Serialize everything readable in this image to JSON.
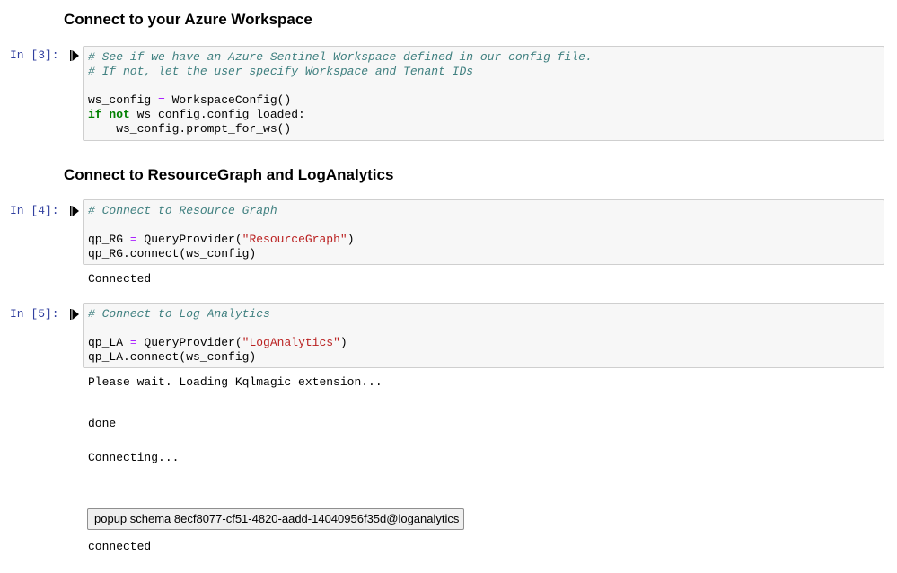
{
  "headings": {
    "workspace": "Connect to your Azure Workspace",
    "resource": "Connect to ResourceGraph and LogAnalytics"
  },
  "cells": [
    {
      "prompt": "In [3]:",
      "icon": "run-cell-icon",
      "lines": {
        "l1": "# See if we have an Azure Sentinel Workspace defined in our config file.",
        "l2": "# If not, let the user specify Workspace and Tenant IDs",
        "l4a": "ws_config ",
        "l4b": "=",
        "l4c": " WorkspaceConfig()",
        "l5a": "if",
        "l5b": " ",
        "l5c": "not",
        "l5d": " ws_config.config_loaded:",
        "l6": "    ws_config.prompt_for_ws()"
      }
    },
    {
      "prompt": "In [4]:",
      "icon": "run-cell-icon",
      "lines": {
        "l1": "# Connect to Resource Graph",
        "l3a": "qp_RG ",
        "l3b": "=",
        "l3c": " QueryProvider(",
        "l3d": "\"ResourceGraph\"",
        "l3e": ")",
        "l4": "qp_RG.connect(ws_config)"
      },
      "output": "Connected"
    },
    {
      "prompt": "In [5]:",
      "icon": "run-cell-icon",
      "lines": {
        "l1": "# Connect to Log Analytics",
        "l3a": "qp_LA ",
        "l3b": "=",
        "l3c": " QueryProvider(",
        "l3d": "\"LogAnalytics\"",
        "l3e": ")",
        "l4": "qp_LA.connect(ws_config)"
      },
      "outputs": {
        "wait": "Please wait. Loading Kqlmagic extension...",
        "done": "done",
        "connecting": "Connecting...",
        "popup_button": "popup schema 8ecf8077-cf51-4820-aadd-14040956f35d@loganalytics",
        "connected": "connected"
      }
    }
  ]
}
